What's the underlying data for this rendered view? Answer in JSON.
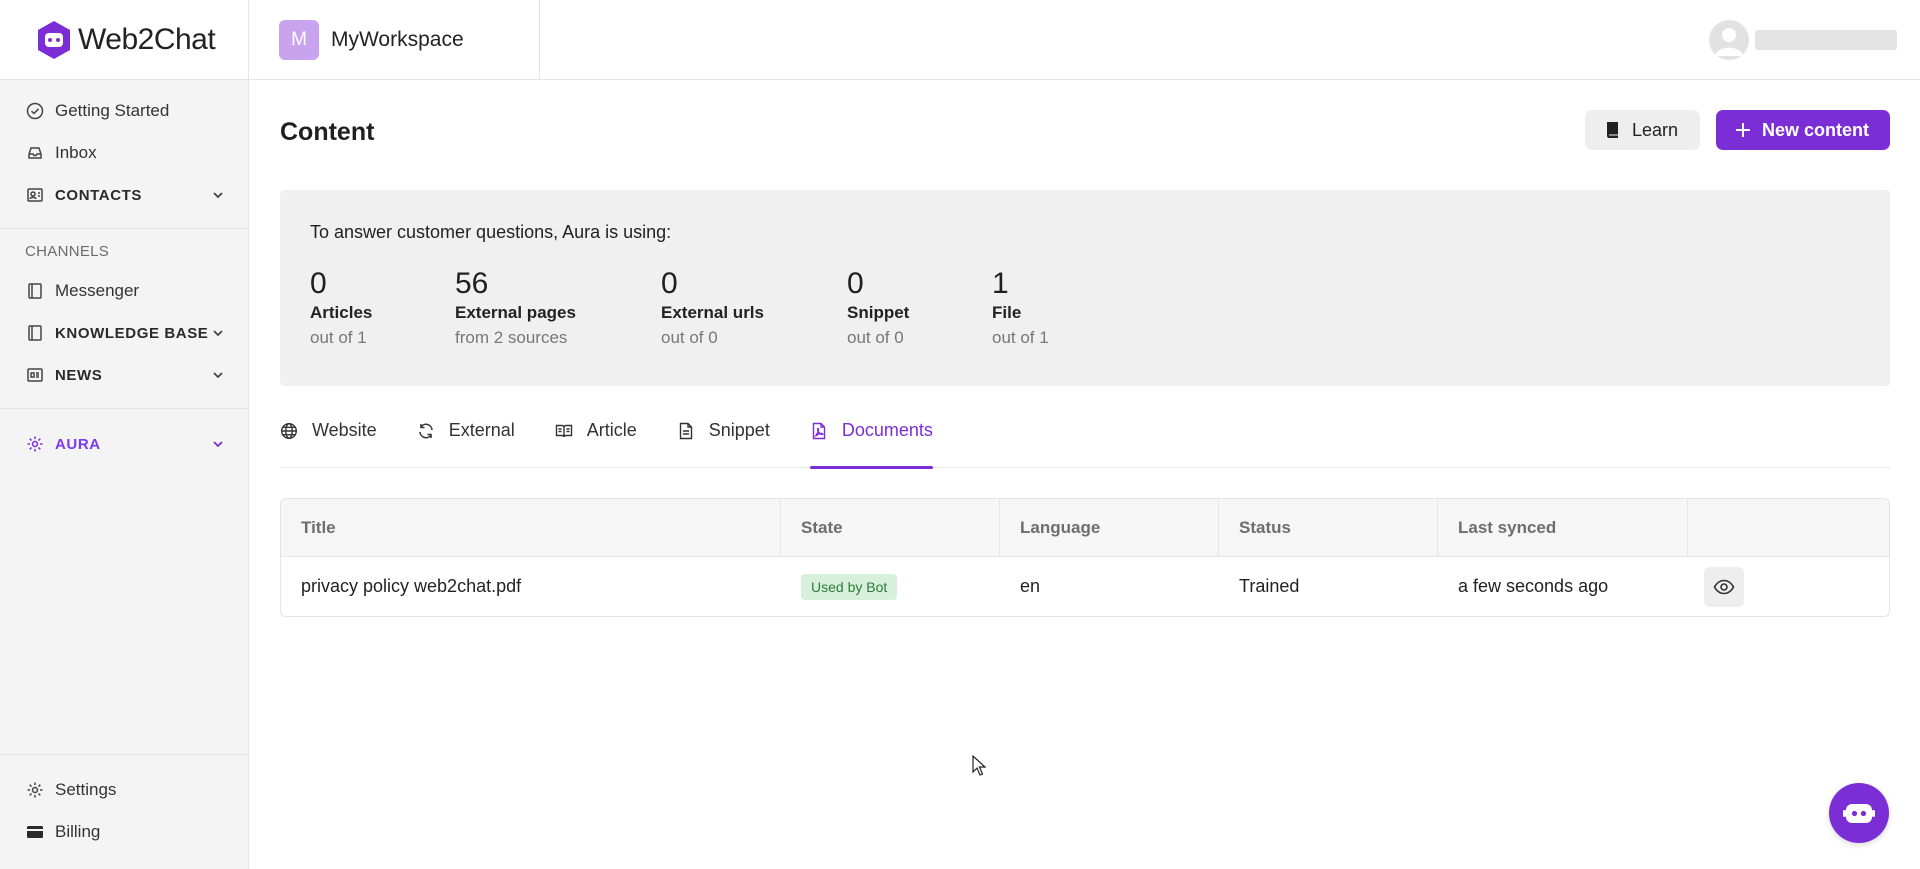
{
  "app": {
    "logo_text": "Web2Chat",
    "accent_color": "#7c2ed6"
  },
  "sidebar": {
    "top_items": [
      {
        "label": "Getting Started",
        "icon": "check-circle-icon"
      },
      {
        "label": "Inbox",
        "icon": "inbox-icon"
      },
      {
        "label": "CONTACTS",
        "icon": "contacts-icon"
      }
    ],
    "channels_heading": "CHANNELS",
    "channel_items": [
      {
        "label": "Messenger",
        "icon": "book-icon"
      },
      {
        "label": "KNOWLEDGE BASE",
        "icon": "book-icon"
      },
      {
        "label": "NEWS",
        "icon": "newspaper-icon"
      }
    ],
    "aura_item": {
      "label": "AURA",
      "icon": "gear-icon"
    },
    "bottom_items": [
      {
        "label": "Settings",
        "icon": "gear-icon"
      },
      {
        "label": "Billing",
        "icon": "credit-card-icon"
      }
    ]
  },
  "topbar": {
    "workspace_initial": "M",
    "workspace_name": "MyWorkspace"
  },
  "page": {
    "title": "Content",
    "learn_label": "Learn",
    "new_content_label": "New content"
  },
  "summary": {
    "intro": "To answer customer questions, Aura is using:",
    "stats": [
      {
        "value": "0",
        "label": "Articles",
        "sub": "out of 1"
      },
      {
        "value": "56",
        "label": "External pages",
        "sub": "from 2 sources"
      },
      {
        "value": "0",
        "label": "External urls",
        "sub": "out of 0"
      },
      {
        "value": "0",
        "label": "Snippet",
        "sub": "out of 0"
      },
      {
        "value": "1",
        "label": "File",
        "sub": "out of 1"
      }
    ]
  },
  "tabs": [
    {
      "label": "Website",
      "icon": "globe-icon"
    },
    {
      "label": "External",
      "icon": "refresh-icon"
    },
    {
      "label": "Article",
      "icon": "open-book-icon"
    },
    {
      "label": "Snippet",
      "icon": "file-icon"
    },
    {
      "label": "Documents",
      "icon": "pdf-file-icon",
      "active": true
    }
  ],
  "table": {
    "headers": [
      "Title",
      "State",
      "Language",
      "Status",
      "Last synced",
      ""
    ],
    "rows": [
      {
        "title": "privacy policy web2chat.pdf",
        "state": "Used by Bot",
        "language": "en",
        "status": "Trained",
        "last_synced": "a few seconds ago"
      }
    ]
  }
}
